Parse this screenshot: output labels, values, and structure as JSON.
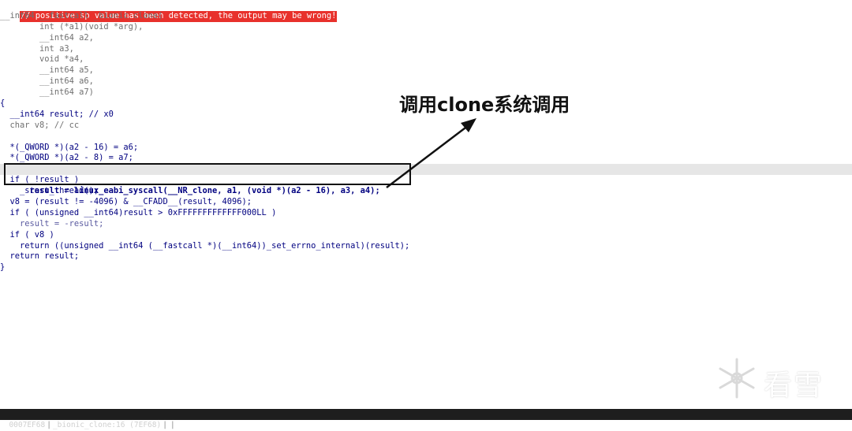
{
  "warning": "// positive sp value has been detected, the output may be wrong!",
  "code_lines": [
    "__int64 __fastcall _bionic_clone(",
    "        int (*a1)(void *arg),",
    "        __int64 a2,",
    "        int a3,",
    "        void *a4,",
    "        __int64 a5,",
    "        __int64 a6,",
    "        __int64 a7)",
    "{",
    "  __int64 result; // x0",
    "  char v8; // cc",
    "",
    "  *(_QWORD *)(a2 - 16) = a6;",
    "  *(_QWORD *)(a2 - 8) = a7;",
    "  result = linux_eabi_syscall(__NR_clone, a1, (void *)(a2 - 16), a3, a4);",
    "  if ( !result )",
    "    _start_thread();",
    "  v8 = (result != -4096) & __CFADD__(result, 4096);",
    "  if ( (unsigned __int64)result > 0xFFFFFFFFFFFFF000LL )",
    "    result = -result;",
    "  if ( v8 )",
    "    return ((unsigned __int64 (__fastcall *)(__int64))_set_errno_internal)(result);",
    "  return result;",
    "}"
  ],
  "annotation": "调用clone系统调用",
  "watermark": "看雪",
  "statusbar": {
    "address": "0007EF68",
    "location": "_bionic_clone:16 (7EF68)"
  },
  "colors": {
    "warning_bg": "#e8312c",
    "highlight_line_bg": "#e6e6e6",
    "statusbar_bg": "#1e1e1e",
    "keyword": "#00008b"
  }
}
